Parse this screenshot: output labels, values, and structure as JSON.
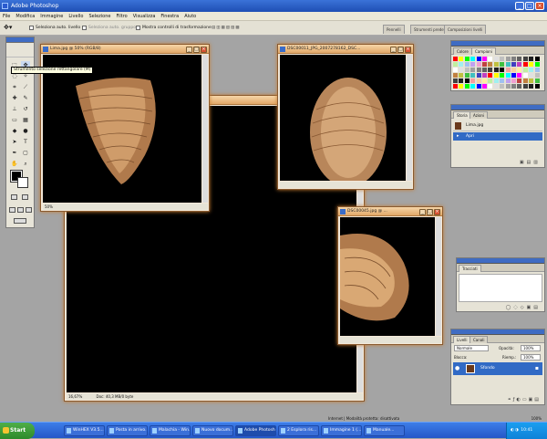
{
  "app": {
    "title": "Adobe Photoshop"
  },
  "menu": [
    "File",
    "Modifica",
    "Immagine",
    "Livello",
    "Selezione",
    "Filtro",
    "Visualizza",
    "Finestra",
    "Aiuto"
  ],
  "options": {
    "auto_select_layers": "Seleziona auto. livello",
    "auto_select_groups": "Seleziona auto. gruppo",
    "show_bounding": "Mostra controlli di trasformazione",
    "palette_tabs": [
      "Pennelli",
      "Strumenti predefiniti",
      "Composizioni livelli"
    ]
  },
  "tooltip": "Strumento selezione rettangolare (M)",
  "documents": {
    "doc1": {
      "title": "Lima.jpg @ 50% (RGB/8)",
      "status": "50%"
    },
    "doc2": {
      "title": "DSC00011_JPG_2007278162_DSC...",
      "status": ""
    },
    "doc3": {
      "title": "DSC00045.jpg @ ...",
      "status": ""
    },
    "doc4": {
      "title": "",
      "status": "Doc: 40,3 MB/0 byte",
      "zoom": "16,67%"
    }
  },
  "panels": {
    "color": {
      "tabs": [
        "Colore",
        "Campioni"
      ]
    },
    "history": {
      "tabs": [
        "Storia",
        "Azioni"
      ],
      "items": [
        "Lima.jpg",
        "Apri"
      ]
    },
    "paths": {
      "tabs": [
        "Tracciati"
      ]
    },
    "layers": {
      "tabs": [
        "Livelli",
        "Canali"
      ],
      "mode": "Normale",
      "opacity_label": "Opacità:",
      "opacity": "100%",
      "fill_label": "Riemp.:",
      "fill": "100%",
      "lock_label": "Blocca:",
      "layer_name": "Sfondo"
    }
  },
  "status": {
    "internet": "Internet | Modalità protetta: disattivata",
    "zoom": "100%"
  },
  "taskbar": {
    "start": "Start",
    "tasks": [
      "WinHEX V3.5...",
      "Posta in arrivo...",
      "Malachia - Win...",
      "Nuovo docum...",
      "Adobe Photosh...",
      "2 Esplora ris...",
      "Immagine 1 (...",
      "Manuale..."
    ],
    "clock": "10:41"
  },
  "colors": {
    "accent": "#3f6cc3",
    "doc_frame": "#c47a30",
    "taskbar": "#2457c8"
  }
}
